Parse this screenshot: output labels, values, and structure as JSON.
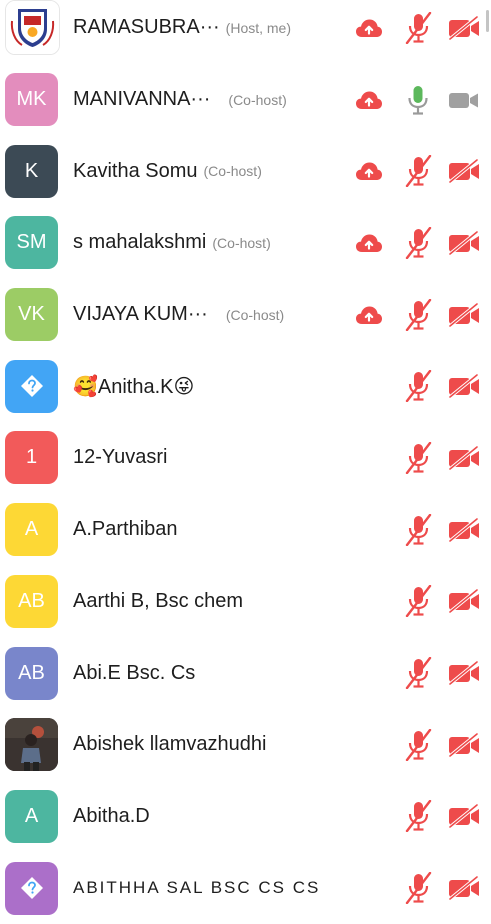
{
  "participants": [
    {
      "avatar_text": "",
      "avatar_color": "#ffffff",
      "avatar_kind": "logo",
      "name": "RAMASUBRA···",
      "role": "(Host, me)",
      "cloud": true,
      "mic": "muted",
      "video": "off"
    },
    {
      "avatar_text": "MK",
      "avatar_color": "#e38dbd",
      "avatar_kind": "initials",
      "name": "MANIVANNA···",
      "role": "(Co-host)",
      "cloud": true,
      "mic": "active",
      "video": "on-gray"
    },
    {
      "avatar_text": "K",
      "avatar_color": "#3c4a55",
      "avatar_kind": "initials",
      "name": "Kavitha Somu",
      "role": "(Co-host)",
      "cloud": true,
      "mic": "muted",
      "video": "off"
    },
    {
      "avatar_text": "SM",
      "avatar_color": "#4db6a0",
      "avatar_kind": "initials",
      "name": "s mahalakshmi",
      "role": "(Co-host)",
      "cloud": true,
      "mic": "muted",
      "video": "off"
    },
    {
      "avatar_text": "VK",
      "avatar_color": "#9ccc65",
      "avatar_kind": "initials",
      "name": "VIJAYA KUM···",
      "role": "(Co-host)",
      "cloud": true,
      "mic": "muted",
      "video": "off"
    },
    {
      "avatar_text": "",
      "avatar_color": "#42a5f5",
      "avatar_kind": "diamond",
      "name": "🥰Anitha.K😜",
      "role": "",
      "cloud": false,
      "mic": "muted",
      "video": "off"
    },
    {
      "avatar_text": "1",
      "avatar_color": "#f25a5a",
      "avatar_kind": "initials",
      "name": "12-Yuvasri",
      "role": "",
      "cloud": false,
      "mic": "muted",
      "video": "off"
    },
    {
      "avatar_text": "A",
      "avatar_color": "#fdd835",
      "avatar_kind": "initials",
      "name": "A.Parthiban",
      "role": "",
      "cloud": false,
      "mic": "muted",
      "video": "off"
    },
    {
      "avatar_text": "AB",
      "avatar_color": "#fdd835",
      "avatar_kind": "initials",
      "name": "Aarthi B, Bsc chem",
      "role": "",
      "cloud": false,
      "mic": "muted",
      "video": "off"
    },
    {
      "avatar_text": "AB",
      "avatar_color": "#7986cb",
      "avatar_kind": "initials",
      "name": "Abi.E Bsc. Cs",
      "role": "",
      "cloud": false,
      "mic": "muted",
      "video": "off"
    },
    {
      "avatar_text": "",
      "avatar_color": "#2b2b2b",
      "avatar_kind": "photo",
      "name": "Abishek llamvazhudhi",
      "role": "",
      "cloud": false,
      "mic": "muted",
      "video": "off"
    },
    {
      "avatar_text": "A",
      "avatar_color": "#4db6a0",
      "avatar_kind": "initials",
      "name": "Abitha.D",
      "role": "",
      "cloud": false,
      "mic": "muted",
      "video": "off"
    }
  ],
  "partial_row": {
    "avatar_color": "#ab6fc9",
    "name": "ABITHHA SAL BSC CS CS"
  },
  "colors": {
    "muted_red": "#ee4b4b",
    "cloud_red": "#ee4b4b",
    "mic_green": "#5cb85c",
    "video_gray": "#a0a0a0"
  }
}
